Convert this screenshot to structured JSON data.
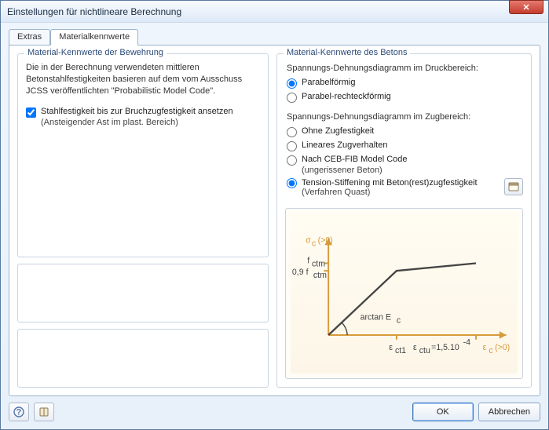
{
  "window": {
    "title": "Einstellungen für nichtlineare Berechnung"
  },
  "tabs": {
    "extras": "Extras",
    "material": "Materialkennwerte"
  },
  "left": {
    "legend": "Material-Kennwerte der Bewehrung",
    "desc": "Die in der Berechnung verwendeten mittleren Betonstahlfestigkeiten basieren auf dem vom Ausschuss JCSS veröffentlichten \"Probabilistic Model Code\".",
    "check_label": "Stahlfestigkeit bis zur Bruchzugfestigkeit ansetzen",
    "check_sub": "(Ansteigender Ast im plast. Bereich)"
  },
  "right": {
    "legend": "Material-Kennwerte des Betons",
    "compression_label": "Spannungs-Dehnungsdiagramm im Druckbereich:",
    "comp_opt_parabel": "Parabelförmig",
    "comp_opt_parrec": "Parabel-rechteckförmig",
    "tension_label": "Spannungs-Dehnungsdiagramm im Zugbereich:",
    "ten_opt_none": "Ohne Zugfestigkeit",
    "ten_opt_linear": "Lineares Zugverhalten",
    "ten_opt_ceb": "Nach CEB-FIB Model Code",
    "ten_opt_ceb_sub": "(ungerissener Beton)",
    "ten_opt_ts": "Tension-Stiffening mit Beton(rest)zugfestigkeit",
    "ten_opt_ts_sub": "(Verfahren Quast)"
  },
  "footer": {
    "ok": "OK",
    "cancel": "Abbrechen"
  },
  "chart_data": {
    "type": "line",
    "title": "",
    "xlabel": "ε_c (>0)",
    "ylabel": "σ_c (>0)",
    "x": [
      "0",
      "ε_ct1",
      "ε_ctu=1,5·10⁻⁴"
    ],
    "series": [
      {
        "name": "σ_c",
        "values": [
          0,
          1.0,
          0.9
        ],
        "y_value_labels": [
          "0",
          "f_ctm",
          "0,9 f_ctm"
        ]
      }
    ],
    "annotations": [
      "arctan E_c"
    ],
    "y_ticks": [
      "0,9 f_ctm",
      "f_ctm"
    ],
    "y_axis_label": "σ_c (>0)",
    "x_axis_label": "ε_c (>0)"
  }
}
